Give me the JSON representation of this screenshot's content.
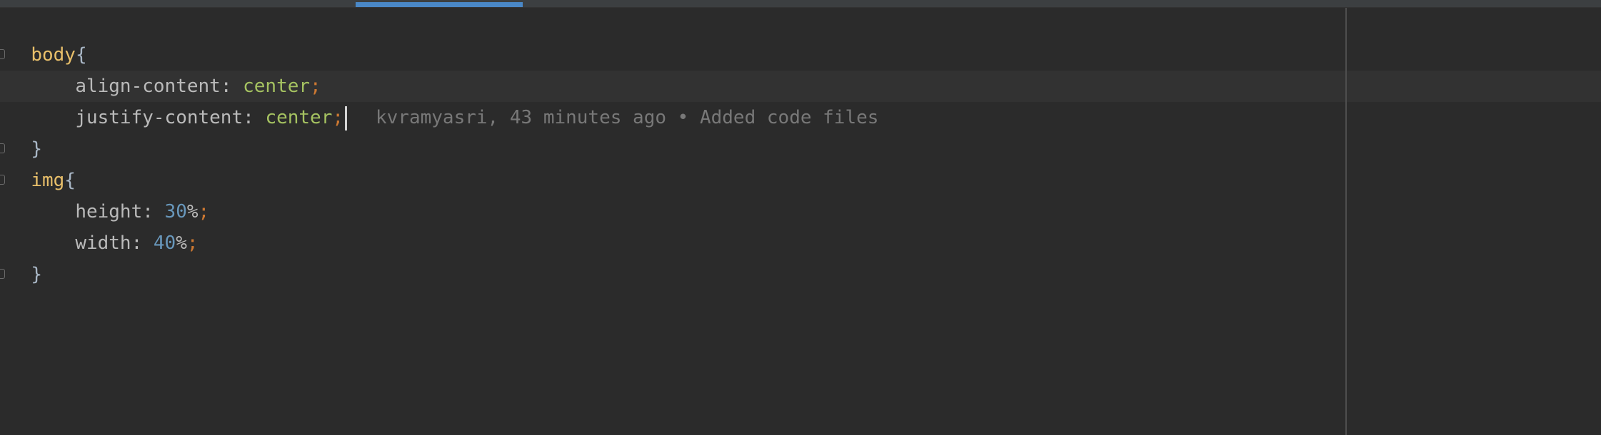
{
  "editor": {
    "lines": [
      {
        "selector": "body",
        "open": "{"
      },
      {
        "prop": "align-content",
        "colon": ": ",
        "value": "center",
        "semi": ";"
      },
      {
        "prop": "justify-content",
        "colon": ": ",
        "value": "center",
        "semi": ";"
      },
      {
        "close": "}"
      },
      {
        "selector": "img",
        "open": "{"
      },
      {
        "prop": "height",
        "colon": ": ",
        "num": "30",
        "unit": "%",
        "semi": ";"
      },
      {
        "prop": "width",
        "colon": ": ",
        "num": "40",
        "unit": "%",
        "semi": ";"
      },
      {
        "close": "}"
      }
    ],
    "blame": "kvramyasri, 43 minutes ago • Added code files"
  },
  "colors": {
    "background": "#2b2b2b",
    "selector": "#e8bf6a",
    "string_value": "#a5c261",
    "number_value": "#6897bb",
    "punctuation": "#cc7832",
    "tab_indicator": "#4a88c7"
  }
}
